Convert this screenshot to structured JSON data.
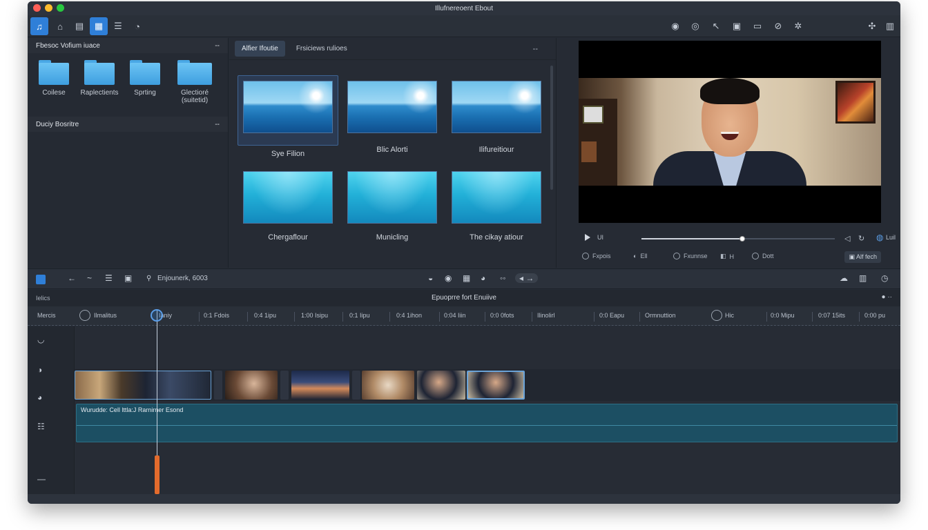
{
  "window": {
    "title": "Illufnereoent Ebout"
  },
  "toolbar": {
    "left_icons": [
      "music-icon",
      "shapes-icon",
      "book-icon",
      "media-icon",
      "list-icon",
      "bell-icon"
    ],
    "right_icons": [
      "globe-icon",
      "eye-icon",
      "cursor-icon",
      "edit-icon",
      "image-icon",
      "link-icon",
      "gear-icon",
      "sparkle-icon",
      "trash-icon"
    ]
  },
  "library": {
    "section1_title": "Fbesoc Vofium iuace",
    "section1_more": "--",
    "folders": [
      {
        "label": "Coilese"
      },
      {
        "label": "Raplectients"
      },
      {
        "label": "Sprting"
      },
      {
        "label": "Glectioré (suitetid)"
      }
    ],
    "section2_title": "Duciy Bosritre",
    "section2_more": "--"
  },
  "effects": {
    "tabs": [
      {
        "label": "Alfier Ifoutie"
      },
      {
        "label": "Frsiciews rulioes"
      }
    ],
    "more": "--",
    "thumbnails": [
      {
        "caption": "Sye Filion"
      },
      {
        "caption": "Blic Alorti"
      },
      {
        "caption": "Ilifureitiour"
      },
      {
        "caption": "Chergaflour"
      },
      {
        "caption": "Municling"
      },
      {
        "caption": "The cikay atiour"
      }
    ]
  },
  "preview": {
    "transport_time": "UI",
    "scrub_progress": 0.52,
    "loop_label": "Luil",
    "options": [
      {
        "label": "Fxpois"
      },
      {
        "label": "Fxunnse"
      },
      {
        "label": "Dott"
      }
    ],
    "opt_misc_1": "Ell",
    "opt_misc_2": "H",
    "apply_label": "Alf fech"
  },
  "timeline": {
    "search_text": "Enjounerk, 6003",
    "header_left": "Ielics",
    "header_title": "Epuoprre fort Enuiive",
    "side_label": "Mercis",
    "ruler_labels": [
      "Ilmalitus",
      "Ianiy",
      "0:1 Fdois",
      "0:4 1ipu",
      "1:00 Isipu",
      "0:1 Iipu",
      "0:4 1ihon",
      "0:04 Iiin",
      "0:0 0fots",
      "Ilinolirl",
      "0:0 Eapu",
      "Ormnuttion",
      "Hic",
      "0:0 Mipu",
      "0:07 15its",
      "0:00 pu"
    ],
    "audio_label": "Wurudde: Cell lttla:J Rarnirner Esond"
  },
  "colors": {
    "accent": "#2f7fd8",
    "audio_track": "#1c4f63",
    "playhead_marker": "#e36b2c",
    "highlight_line": "#f2d640"
  }
}
